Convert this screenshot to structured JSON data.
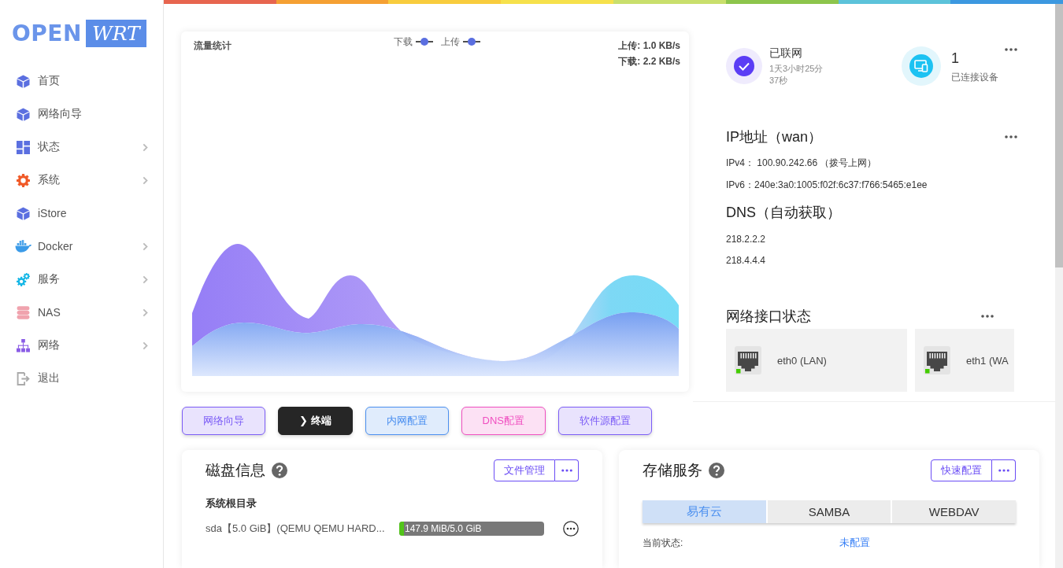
{
  "logo": {
    "wordmark": "OPEN",
    "badge": "WRT"
  },
  "sidebar": {
    "items": [
      {
        "label": "首页",
        "expandable": false,
        "selected": false
      },
      {
        "label": "网络向导",
        "expandable": false,
        "selected": false
      },
      {
        "label": "状态",
        "expandable": true,
        "selected": false
      },
      {
        "label": "系统",
        "expandable": true,
        "selected": false
      },
      {
        "label": "iStore",
        "expandable": false,
        "selected": false
      },
      {
        "label": "Docker",
        "expandable": true,
        "selected": false
      },
      {
        "label": "服务",
        "expandable": true,
        "selected": false
      },
      {
        "label": "NAS",
        "expandable": true,
        "selected": false
      },
      {
        "label": "网络",
        "expandable": true,
        "selected": false
      },
      {
        "label": "退出",
        "expandable": false,
        "selected": false
      }
    ]
  },
  "traffic_chart": {
    "title": "流量统计",
    "legend": [
      "下载",
      "上传"
    ],
    "rates": [
      "上传: 1.0 KB/s",
      "下载: 2.2 KB/s"
    ]
  },
  "connection": {
    "status": "已联网",
    "uptime": "1天3小时25分37秒"
  },
  "devices": {
    "count": "1",
    "label": "已连接设备"
  },
  "wan_ip": {
    "title": "IP地址（wan）",
    "lines": [
      "IPv4： 100.90.242.66 （拨号上网）",
      "IPv6：240e:3a0:1005:f02f:6c37:f766:5465:e1ee"
    ]
  },
  "dns": {
    "title": "DNS（自动获取）",
    "servers": [
      "218.2.2.2",
      "218.4.4.4"
    ]
  },
  "network_interfaces": {
    "title": "网络接口状态",
    "items": [
      {
        "name": "eth0 (LAN)",
        "up": true
      },
      {
        "name": "eth1 (WA",
        "up": true
      }
    ]
  },
  "quick_actions": [
    {
      "label": "网络向导",
      "kind": "outline",
      "color": "#7b5cf6"
    },
    {
      "label": "❯ 终端",
      "kind": "solid",
      "color": "#262626"
    },
    {
      "label": "内网配置",
      "kind": "outline",
      "color": "#4a8ff0"
    },
    {
      "label": "DNS配置",
      "kind": "outline",
      "color": "#f04fc0"
    },
    {
      "label": "软件源配置",
      "kind": "outline",
      "color": "#7b5cf6"
    }
  ],
  "disk_info": {
    "title": "磁盘信息",
    "action": "文件管理",
    "section": "系统根目录",
    "disks": [
      {
        "name": "sda【5.0 GiB】(QEMU QEMU HARD...",
        "usage": "147.9 MiB/5.0 GiB",
        "level": 0.03
      }
    ]
  },
  "storage_service": {
    "title": "存储服务",
    "action": "快速配置",
    "tabs": [
      {
        "label": "易有云",
        "selected": true
      },
      {
        "label": "SAMBA",
        "selected": false
      },
      {
        "label": "WEBDAV",
        "selected": false
      }
    ],
    "status_label": "当前状态:",
    "status_value": "未配置"
  }
}
